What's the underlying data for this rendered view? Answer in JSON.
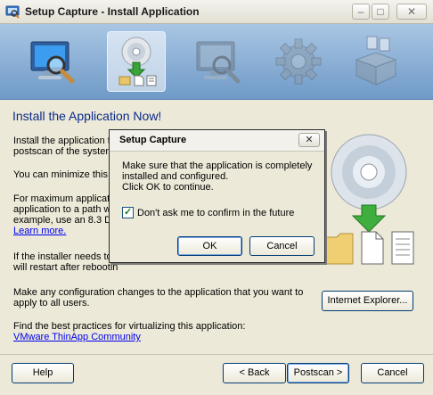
{
  "window": {
    "title": "Setup Capture - Install Application",
    "controls": {
      "minimize": "–",
      "maximize": "□",
      "close": "✕"
    }
  },
  "steps": [
    {
      "icon": "monitor-magnifier-icon",
      "state": "done"
    },
    {
      "icon": "disc-install-icon",
      "state": "active"
    },
    {
      "icon": "monitor-magnifier-icon",
      "state": "pending"
    },
    {
      "icon": "gear-icon",
      "state": "pending"
    },
    {
      "icon": "package-icon",
      "state": "pending"
    }
  ],
  "main": {
    "heading": "Install the Application Now!",
    "p1_line1": "Install the application t",
    "p1_line2": "postscan of the system",
    "p2": "You can minimize this w",
    "p3_line1": "For maximum applicatio",
    "p3_line2": "application to a path w",
    "p3_line3": "example, use an 8.3 DO",
    "p3_link": "Learn more.",
    "p4_line1": "If the installer needs to",
    "p4_line2": "will restart after rebootin",
    "p5_line1": "Make any configuration changes to the application that you want to",
    "p5_line2": "apply to all users.",
    "p6": "Find the best practices for virtualizing this application:",
    "p6_link": "VMware ThinApp Community",
    "ie_button": "Internet Explorer..."
  },
  "footer": {
    "help": "Help",
    "back": "< Back",
    "postscan": "Postscan >",
    "cancel": "Cancel"
  },
  "dialog": {
    "title": "Setup Capture",
    "close": "✕",
    "message_line1": "Make sure that the application is completely",
    "message_line2": "installed and configured.",
    "message_line3": "Click OK to continue.",
    "checkbox_label": "Don't ask me to confirm in the future",
    "checkbox_checked": "✓",
    "ok": "OK",
    "cancel": "Cancel"
  },
  "colors": {
    "heading": "#0b2a88",
    "link": "#0000ee",
    "strip_top": "#a9c6e4",
    "strip_bottom": "#6f9ac7"
  }
}
